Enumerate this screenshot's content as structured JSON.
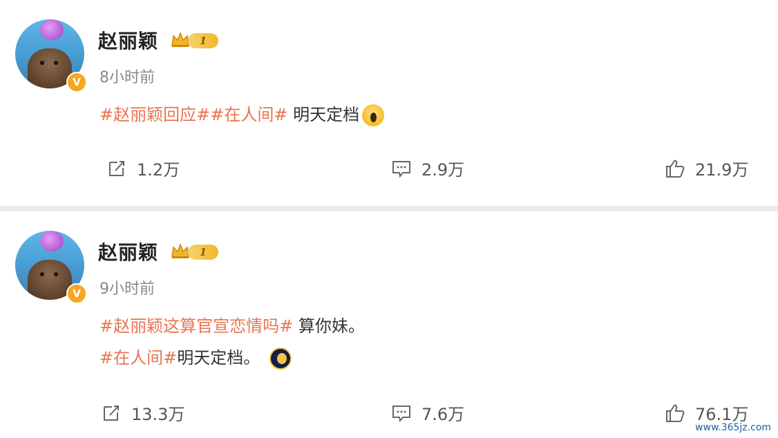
{
  "posts": [
    {
      "username": "赵丽颖",
      "level": "1",
      "time": "8小时前",
      "lines": [
        {
          "topics": [
            "#赵丽颖回应#",
            "#在人间#"
          ],
          "text": " 明天定档",
          "emoji": "crying-face-icon"
        }
      ],
      "actions": {
        "repost": "1.2万",
        "comment": "2.9万",
        "like": "21.9万"
      }
    },
    {
      "username": "赵丽颖",
      "level": "1",
      "time": "9小时前",
      "lines": [
        {
          "topics": [
            "#赵丽颖这算官宣恋情吗#"
          ],
          "text": " 算你妹。"
        },
        {
          "topics": [
            "#在人间#"
          ],
          "text": "明天定档。",
          "emoji": "moon-face-icon"
        }
      ],
      "actions": {
        "repost": "13.3万",
        "comment": "7.6万",
        "like": "76.1万"
      }
    }
  ],
  "watermark": "www.365jz.com",
  "colors": {
    "topic": "#eb7350",
    "verified_badge": "#f6a623",
    "level_badge": "#f1b82e",
    "background": "#ececec"
  }
}
